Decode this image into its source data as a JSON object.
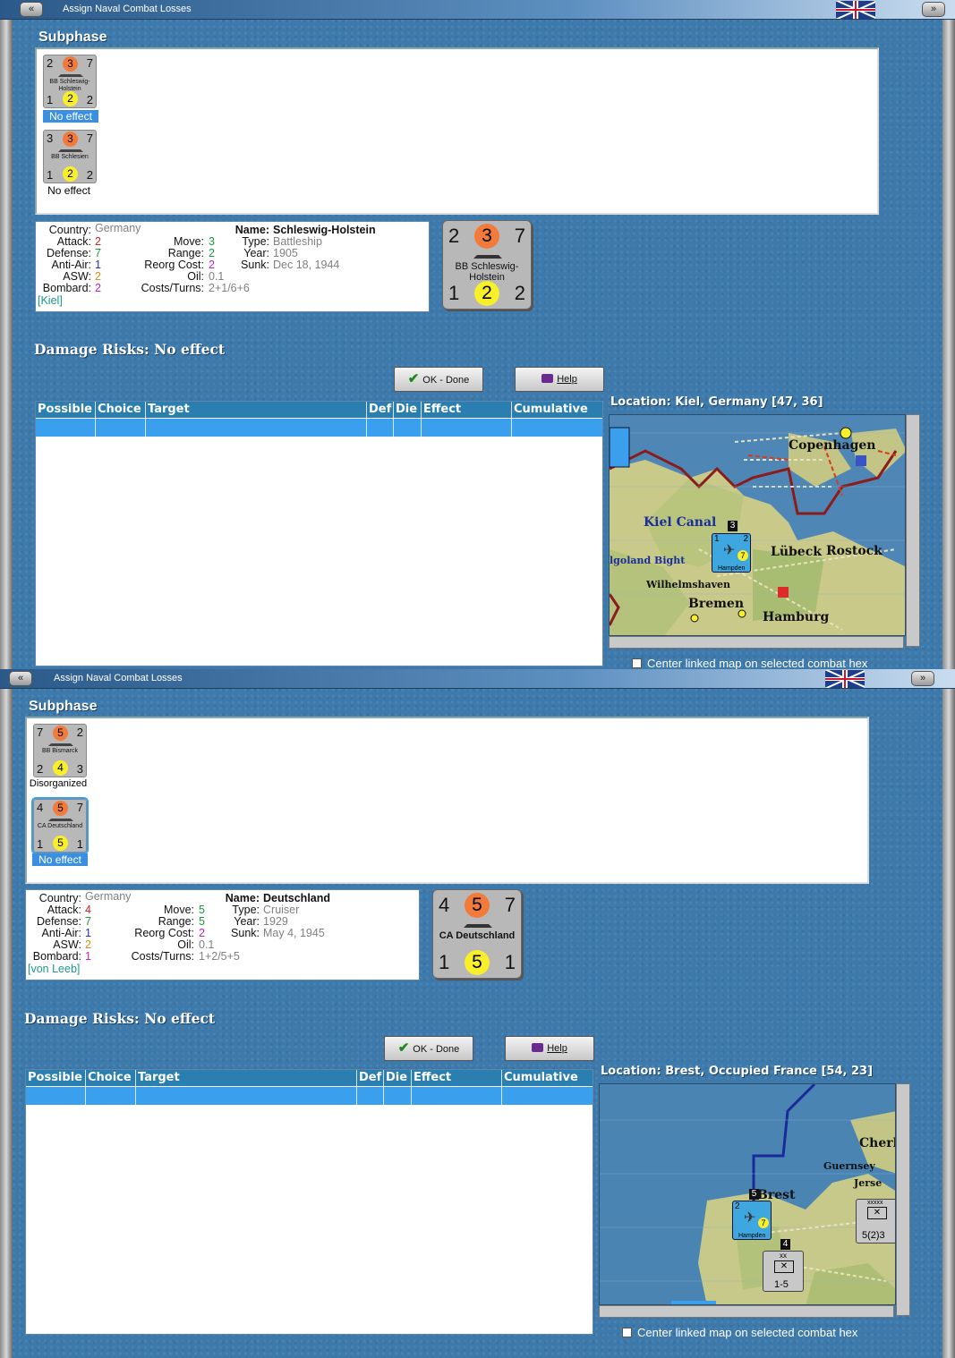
{
  "windows": [
    {
      "title": "Assign Naval Combat Losses",
      "subphase": "Subphase",
      "units": [
        {
          "tl": "2",
          "tc": "3",
          "tr": "7",
          "name": "BB Schleswig-Holstein",
          "bl": "1",
          "bc": "2",
          "br": "2",
          "status": "No effect",
          "selected": true
        },
        {
          "tl": "3",
          "tc": "3",
          "tr": "7",
          "name": "BB Schlesien",
          "bl": "1",
          "bc": "2",
          "br": "2",
          "status": "No effect",
          "selected": false
        }
      ],
      "info": {
        "country_label": "Country:",
        "country": "Germany",
        "attack_label": "Attack:",
        "attack": "2",
        "defense_label": "Defense:",
        "defense": "7",
        "antiair_label": "Anti-Air:",
        "antiair": "1",
        "asw_label": "ASW:",
        "asw": "2",
        "bombard_label": "Bombard:",
        "bombard": "2",
        "location": "[Kiel]",
        "move_label": "Move:",
        "move": "3",
        "range_label": "Range:",
        "range": "2",
        "reorg_label": "Reorg Cost:",
        "reorg": "2",
        "oil_label": "Oil:",
        "oil": "0.1",
        "costs_label": "Costs/Turns:",
        "costs": "2+1/6+6",
        "name_label": "Name:",
        "name": "Schleswig-Holstein",
        "type_label": "Type:",
        "type": "Battleship",
        "year_label": "Year:",
        "year": "1905",
        "sunk_label": "Sunk:",
        "sunk": "Dec 18, 1944"
      },
      "big": {
        "tl": "2",
        "tc": "3",
        "tr": "7",
        "name": "BB Schleswig-Holstein",
        "bl": "1",
        "bc": "2",
        "br": "2"
      },
      "damage": "Damage Risks:  No effect",
      "ok": "OK - Done",
      "help": "Help",
      "columns": [
        "Possible",
        "Choice",
        "Target",
        "Def",
        "Die",
        "Effect",
        "Cumulative"
      ],
      "location": "Location:  Kiel, Germany [47, 36]",
      "map_labels": [
        "Copenhagen",
        "Kiel Canal",
        "Lübeck",
        "Rostock",
        "lgoland Bight",
        "Wilhelmshaven",
        "Bremen",
        "Hamburg"
      ],
      "map_unit": {
        "tl": "1",
        "tr": "2",
        "bl": "3",
        "name": "Hampden",
        "br": "3",
        "mid": "7",
        "top": "3"
      },
      "center_label": "Center linked map on selected combat hex"
    },
    {
      "title": "Assign Naval Combat Losses",
      "subphase": "Subphase",
      "units": [
        {
          "tl": "7",
          "tc": "5",
          "tr": "2",
          "name": "BB Bismarck",
          "bl": "2",
          "bc": "4",
          "br": "3",
          "status": "Disorganized",
          "selected": false
        },
        {
          "tl": "4",
          "tc": "5",
          "tr": "7",
          "name": "CA Deutschland",
          "bl": "1",
          "bc": "5",
          "br": "1",
          "status": "No effect",
          "selected": true
        }
      ],
      "info": {
        "country_label": "Country:",
        "country": "Germany",
        "attack_label": "Attack:",
        "attack": "4",
        "defense_label": "Defense:",
        "defense": "7",
        "antiair_label": "Anti-Air:",
        "antiair": "1",
        "asw_label": "ASW:",
        "asw": "2",
        "bombard_label": "Bombard:",
        "bombard": "1",
        "location": "[von Leeb]",
        "move_label": "Move:",
        "move": "5",
        "range_label": "Range:",
        "range": "5",
        "reorg_label": "Reorg Cost:",
        "reorg": "2",
        "oil_label": "Oil:",
        "oil": "0.1",
        "costs_label": "Costs/Turns:",
        "costs": "1+2/5+5",
        "name_label": "Name:",
        "name": "Deutschland",
        "type_label": "Type:",
        "type": "Cruiser",
        "year_label": "Year:",
        "year": "1929",
        "sunk_label": "Sunk:",
        "sunk": "May 4, 1945"
      },
      "big": {
        "tl": "4",
        "tc": "5",
        "tr": "7",
        "name": "CA Deutschland",
        "bl": "1",
        "bc": "5",
        "br": "1"
      },
      "damage": "Damage Risks:  No effect",
      "ok": "OK - Done",
      "help": "Help",
      "columns": [
        "Possible",
        "Choice",
        "Target",
        "Def",
        "Die",
        "Effect",
        "Cumulative"
      ],
      "location": "Location:  Brest, Occupied France [54, 23]",
      "map_labels": [
        "Cherl",
        "Guernsey",
        "Jerse",
        "Brest"
      ],
      "map_unit": {
        "tl": "2",
        "tr": "",
        "bl": "3",
        "name": "Hampden",
        "br": "3",
        "mid": "7",
        "top": "5"
      },
      "map_unit2": {
        "top": "xx",
        "val": "1-5",
        "num": "4"
      },
      "map_unit3": {
        "top": "xxxxx",
        "val": "5(2)3"
      },
      "center_label": "Center linked map on selected combat hex"
    }
  ],
  "colors": {
    "attack": "#d42020",
    "defense": "#1a9a3a",
    "antiair": "#2030c8",
    "asw": "#e08a10",
    "bombard": "#c020c0",
    "muted": "#808080",
    "location": "#1a9a8a",
    "selected": "#3aa0ee"
  },
  "icons": [
    "minimize-icon",
    "close-icon",
    "union-jack-flag",
    "check-icon",
    "help-book-icon"
  ]
}
